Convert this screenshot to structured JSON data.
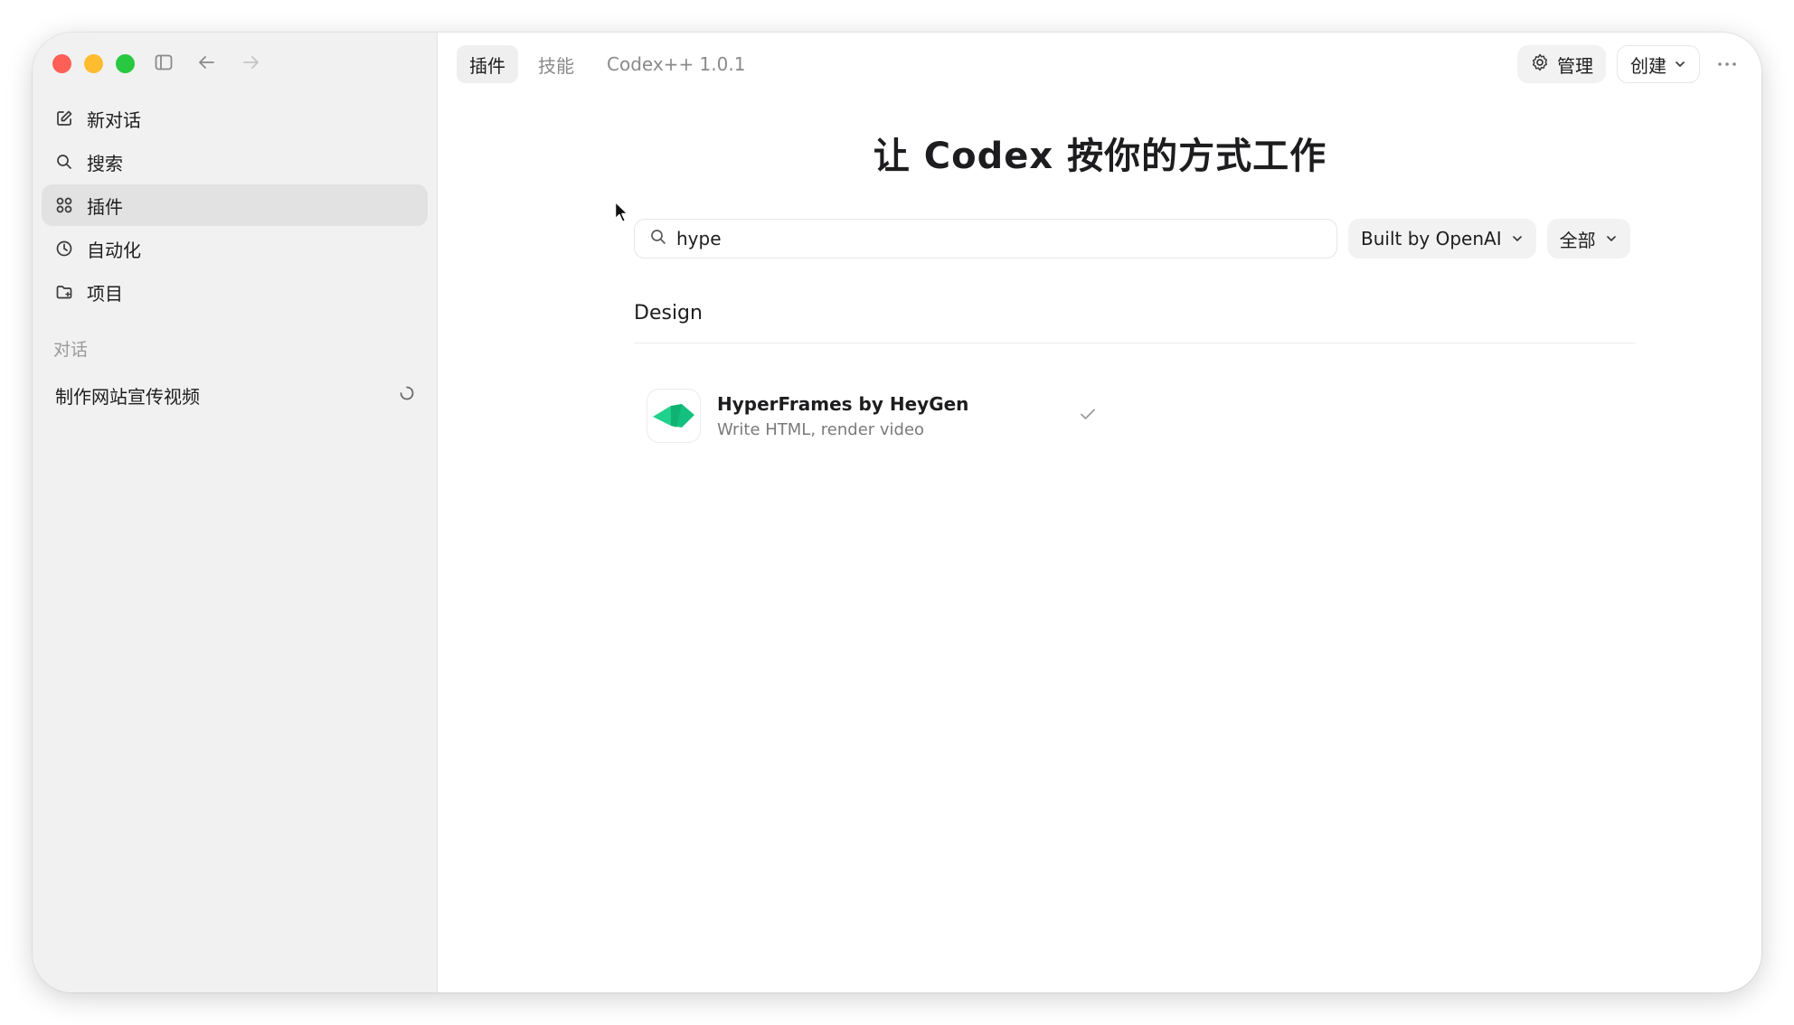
{
  "window": {
    "traffic_lights": [
      "close",
      "minimize",
      "zoom"
    ]
  },
  "sidebar": {
    "items": [
      {
        "label": "新对话",
        "icon": "compose-icon"
      },
      {
        "label": "搜索",
        "icon": "search-icon"
      },
      {
        "label": "插件",
        "icon": "plugins-icon",
        "active": true
      },
      {
        "label": "自动化",
        "icon": "clock-icon"
      },
      {
        "label": "项目",
        "icon": "folder-icon"
      }
    ],
    "section_label": "对话",
    "conversations": [
      {
        "title": "制作网站宣传视频",
        "status": "loading"
      }
    ]
  },
  "header": {
    "tabs": [
      {
        "label": "插件",
        "active": true
      },
      {
        "label": "技能",
        "active": false
      },
      {
        "label": "Codex++ 1.0.1",
        "active": false
      }
    ],
    "manage_label": "管理",
    "create_label": "创建"
  },
  "main": {
    "title": "让 Codex 按你的方式工作",
    "search": {
      "value": "hype",
      "placeholder": ""
    },
    "filters": {
      "builder": "Built by OpenAI",
      "scope": "全部"
    },
    "categories": [
      {
        "name": "Design",
        "plugins": [
          {
            "name": "HyperFrames by HeyGen",
            "description": "Write HTML, render video",
            "installed": true
          }
        ]
      }
    ]
  },
  "colors": {
    "accent_green": "#1fd18a",
    "close": "#fe5f57",
    "minimize": "#febc2e",
    "zoom": "#28c840"
  }
}
